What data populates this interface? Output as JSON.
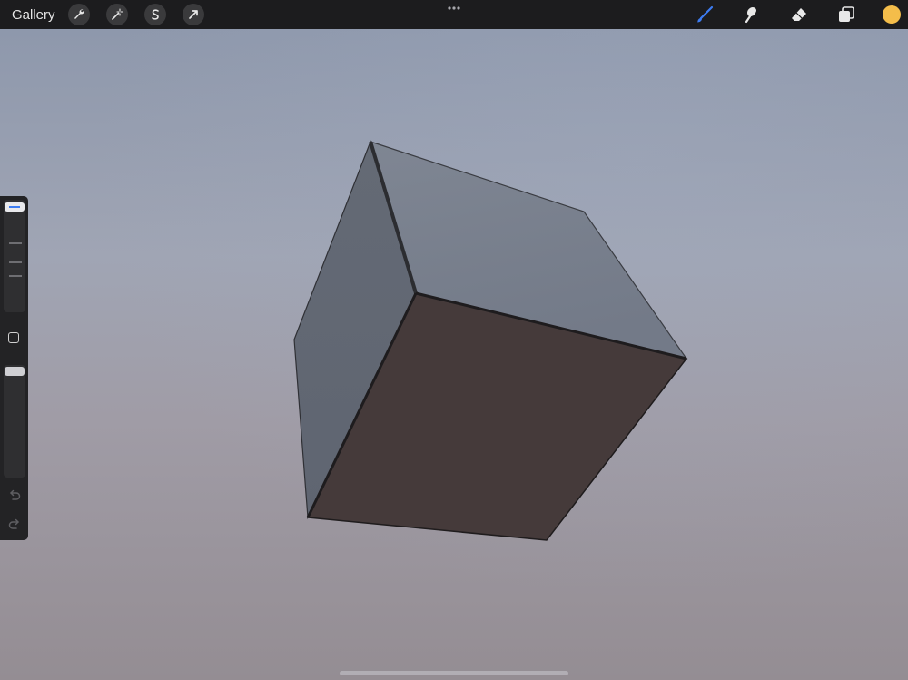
{
  "topbar": {
    "gallery_label": "Gallery",
    "left_tools": [
      {
        "name": "actions",
        "icon": "wrench-icon"
      },
      {
        "name": "adjustments",
        "icon": "magic-wand-icon"
      },
      {
        "name": "selection",
        "icon": "selection-s-icon"
      },
      {
        "name": "transform",
        "icon": "arrow-cursor-icon"
      }
    ],
    "more_icon": "more-dots-icon",
    "right_tools": [
      {
        "name": "brush",
        "icon": "brush-icon",
        "active": true
      },
      {
        "name": "smudge",
        "icon": "smudge-icon",
        "active": false
      },
      {
        "name": "eraser",
        "icon": "eraser-icon",
        "active": false
      },
      {
        "name": "layers",
        "icon": "layers-icon",
        "active": false
      }
    ],
    "current_color": "#f4bd4a",
    "active_color": "#3d7cf2"
  },
  "sidebar": {
    "brush_size_icon": "size-slider",
    "modify_icon": "square-icon",
    "opacity_icon": "opacity-slider",
    "undo_icon": "undo-icon",
    "redo_icon": "redo-icon"
  },
  "canvas": {
    "subject": "3D cube",
    "colors": {
      "top_face": "#7a818d",
      "left_face": "#686f7a",
      "front_face": "#453a3a",
      "edge": "#2b2c30"
    }
  }
}
